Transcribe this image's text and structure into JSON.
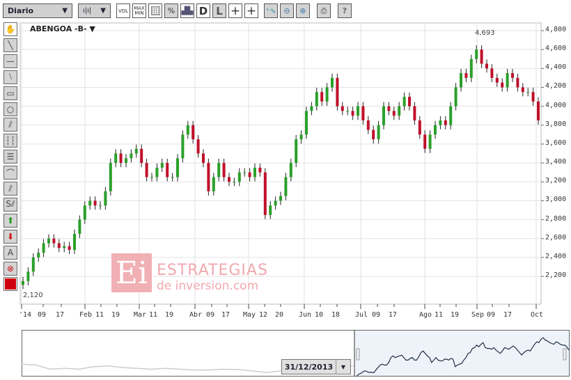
{
  "toolbar": {
    "period": "Diario",
    "vol": "VOL",
    "max": "MAX",
    "min": "MIN",
    "pct": "%",
    "d": "D",
    "l": "L",
    "help": "?"
  },
  "chart": {
    "symbol": "ABENGOA -B-",
    "max_label": "4,693",
    "min_label": "2,120"
  },
  "watermark": {
    "line1": "ESTRATEGIAS",
    "line2": "de inversion.com"
  },
  "navigator": {
    "date": "31/12/2013"
  },
  "colors": {
    "up": "#2aa02a",
    "down": "#c0102a",
    "grid": "#e2e2e2"
  },
  "chart_data": {
    "type": "candlestick",
    "y_ticks": [
      "4,800",
      "4,600",
      "4,400",
      "4,200",
      "4,000",
      "3,800",
      "3,600",
      "3,400",
      "3,200",
      "3,000",
      "2,800",
      "2,600",
      "2,400",
      "2,200"
    ],
    "ylim": [
      1950,
      4800
    ],
    "x_labels": [
      "'14",
      "09",
      "17",
      "Feb",
      "11",
      "19",
      "Mar",
      "11",
      "19",
      "Abr",
      "09",
      "17",
      "May",
      "12",
      "20",
      "Jun",
      "10",
      "18",
      "Jul",
      "09",
      "17",
      "Ago",
      "11",
      "19",
      "Sep",
      "09",
      "17",
      "Oct"
    ],
    "closes": [
      2150,
      2250,
      2400,
      2450,
      2550,
      2600,
      2550,
      2500,
      2520,
      2480,
      2650,
      2800,
      2950,
      3000,
      2950,
      2950,
      3100,
      3400,
      3500,
      3400,
      3450,
      3500,
      3550,
      3400,
      3250,
      3250,
      3350,
      3400,
      3250,
      3250,
      3450,
      3700,
      3800,
      3650,
      3500,
      3400,
      3100,
      3250,
      3400,
      3250,
      3200,
      3200,
      3300,
      3300,
      3250,
      3350,
      3300,
      2850,
      2950,
      3000,
      3050,
      3250,
      3400,
      3650,
      3700,
      3950,
      4000,
      4150,
      4050,
      4200,
      4300,
      4000,
      3950,
      3950,
      3900,
      4000,
      3850,
      3750,
      3650,
      3800,
      4000,
      3950,
      3900,
      4000,
      4100,
      4000,
      3850,
      3700,
      3550,
      3700,
      3800,
      3850,
      3800,
      4000,
      4200,
      4350,
      4300,
      4500,
      4600,
      4450,
      4400,
      4300,
      4250,
      4200,
      4350,
      4300,
      4200,
      4150,
      4150,
      4050,
      3850
    ],
    "navigator_2013": [
      3000,
      2950,
      2700,
      2750,
      2700,
      2850,
      2900,
      2800,
      2750,
      2700,
      2750,
      2700,
      2650,
      2650,
      2700,
      2680,
      2600,
      2500,
      2600,
      2700,
      2800,
      2750,
      2850,
      2900
    ]
  }
}
